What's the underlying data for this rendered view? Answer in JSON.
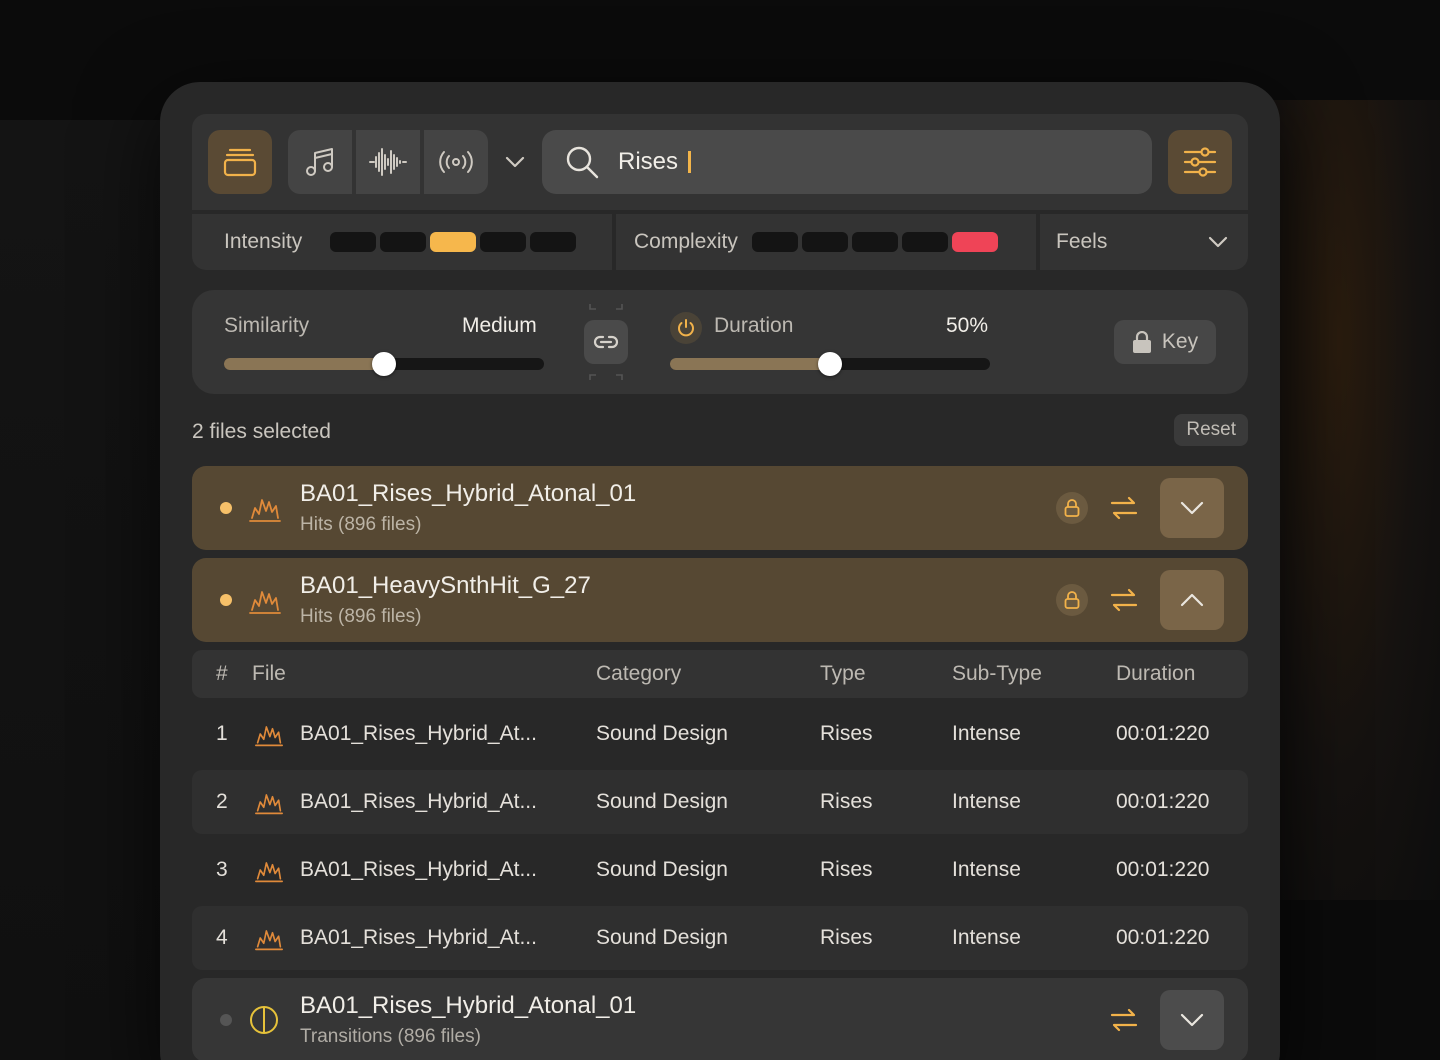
{
  "toolbar": {
    "library_icon": "library-stack-icon",
    "modes": [
      {
        "name": "music-note-icon"
      },
      {
        "name": "waveform-icon"
      },
      {
        "name": "broadcast-icon"
      }
    ],
    "search_value": "Rises",
    "accent_color": "#f6b74c"
  },
  "attributes": {
    "intensity_label": "Intensity",
    "intensity_level": 3,
    "complexity_label": "Complexity",
    "complexity_level": 5,
    "feels_label": "Feels"
  },
  "sliders": {
    "similarity_label": "Similarity",
    "similarity_value": "Medium",
    "similarity_fraction": 0.5,
    "duration_label": "Duration",
    "duration_value": "50%",
    "duration_fraction": 0.5,
    "key_label": "Key"
  },
  "selection": {
    "text": "2 files selected",
    "reset_label": "Reset"
  },
  "groups": [
    {
      "title": "BA01_Rises_Hybrid_Atonal_01",
      "subtitle": "Hits (896 files)",
      "expanded": false
    },
    {
      "title": "BA01_HeavySnthHit_G_27",
      "subtitle": "Hits (896 files)",
      "expanded": true
    }
  ],
  "table": {
    "headers": {
      "num": "#",
      "file": "File",
      "category": "Category",
      "type": "Type",
      "subtype": "Sub-Type",
      "duration": "Duration"
    },
    "rows": [
      {
        "num": "1",
        "file": "BA01_Rises_Hybrid_At...",
        "category": "Sound Design",
        "type": "Rises",
        "subtype": "Intense",
        "duration": "00:01:220"
      },
      {
        "num": "2",
        "file": "BA01_Rises_Hybrid_At...",
        "category": "Sound Design",
        "type": "Rises",
        "subtype": "Intense",
        "duration": "00:01:220"
      },
      {
        "num": "3",
        "file": "BA01_Rises_Hybrid_At...",
        "category": "Sound Design",
        "type": "Rises",
        "subtype": "Intense",
        "duration": "00:01:220"
      },
      {
        "num": "4",
        "file": "BA01_Rises_Hybrid_At...",
        "category": "Sound Design",
        "type": "Rises",
        "subtype": "Intense",
        "duration": "00:01:220"
      }
    ]
  },
  "bottom_group": {
    "title": "BA01_Rises_Hybrid_Atonal_01",
    "subtitle": "Transitions (896 files)"
  }
}
